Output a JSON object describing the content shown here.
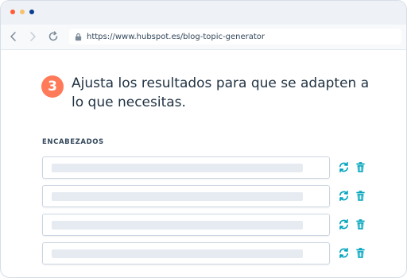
{
  "browser": {
    "url": "https://www.hubspot.es/blog-topic-generator"
  },
  "step": {
    "number": "3",
    "title": "Ajusta los resultados para que se adapten a lo que necesitas."
  },
  "section": {
    "label": "ENCABEZADOS"
  },
  "headlines": [
    {
      "value": ""
    },
    {
      "value": ""
    },
    {
      "value": ""
    },
    {
      "value": ""
    }
  ],
  "colors": {
    "accent_orange": "#ff7a59",
    "teal_action": "#00a4bd",
    "text_dark": "#213343"
  },
  "icons": {
    "back": "chevron-left-icon",
    "forward": "chevron-right-icon",
    "reload": "reload-icon",
    "lock": "lock-icon",
    "regenerate": "refresh-icon",
    "delete": "trash-icon"
  }
}
